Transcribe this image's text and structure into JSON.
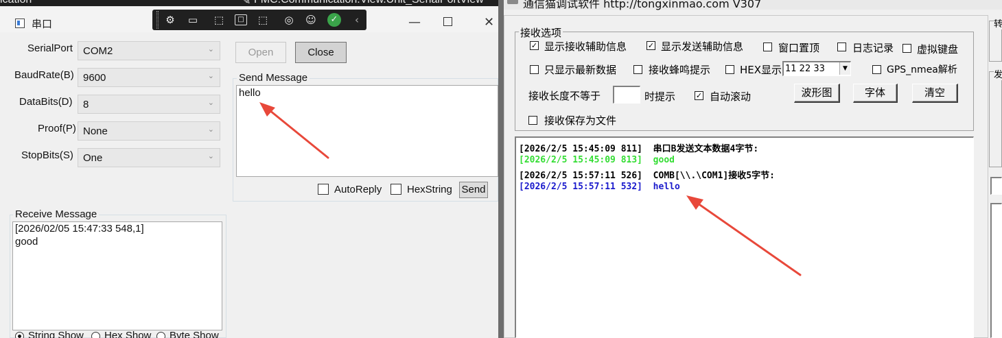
{
  "taskbar_strip": {
    "left_text": "ication",
    "mid_text": "FMC.Communication.View.Unit_SerialPortView"
  },
  "left_window": {
    "title": "串口",
    "fields": {
      "serial_port": {
        "label": "SerialPort",
        "value": "COM2"
      },
      "baud_rate": {
        "label": "BaudRate(B)",
        "value": "9600"
      },
      "data_bits": {
        "label": "DataBits(D)",
        "value": "8"
      },
      "proof": {
        "label": "Proof(P)",
        "value": "None"
      },
      "stop_bits": {
        "label": "StopBits(S)",
        "value": "One"
      }
    },
    "buttons": {
      "open": "Open",
      "close": "Close",
      "send": "Send"
    },
    "send_group": {
      "title": "Send Message",
      "text": "hello"
    },
    "options": {
      "auto_reply": "AutoReply",
      "hex_string": "HexString"
    },
    "receive_group": {
      "title": "Receive Message",
      "line1": "[2026/02/05 15:47:33 548,1]",
      "line2": "good"
    },
    "show_modes": {
      "string": "String Show",
      "hex": "Hex Show",
      "byte": "Byte Show",
      "selected": "String Show"
    }
  },
  "right_window": {
    "title": "通信猫调试软件  http://tongxinmao.com  V307",
    "receive_options_title": "接收选项",
    "options": {
      "show_recv_info": "显示接收辅助信息",
      "show_send_info": "显示发送辅助信息",
      "topmost": "窗口置顶",
      "log": "日志记录",
      "virtual_keyboard": "虚拟键盘",
      "only_latest": "只显示最新数据",
      "beep": "接收蜂鸣提示",
      "hex_show": "HEX显示",
      "hex_combo": "11 22 33",
      "gps": "GPS_nmea解析",
      "len_prefix": "接收长度不等于",
      "len_suffix": "时提示",
      "auto_scroll": "自动滚动",
      "save_to_file": "接收保存为文件"
    },
    "checked": {
      "show_recv_info": true,
      "show_send_info": true,
      "auto_scroll": true
    },
    "buttons": {
      "waveform": "波形图",
      "font": "字体",
      "clear": "清空"
    },
    "log": [
      {
        "text": "[2026/2/5 15:45:09 811]  串口B发送文本数据4字节:",
        "color": "#000000"
      },
      {
        "text": "[2026/2/5 15:45:09 813]  good",
        "color": "#33dd33"
      },
      {
        "text": "[2026/2/5 15:57:11 526]  COMB[\\\\.\\COM1]接收5字节:",
        "color": "#000000"
      },
      {
        "text": "[2026/2/5 15:57:11 532]  hello",
        "color": "#1a1acc"
      }
    ],
    "edge_labels": {
      "top": "转",
      "mid": "发"
    }
  },
  "colors": {
    "annotation_arrow": "#e8483a"
  }
}
